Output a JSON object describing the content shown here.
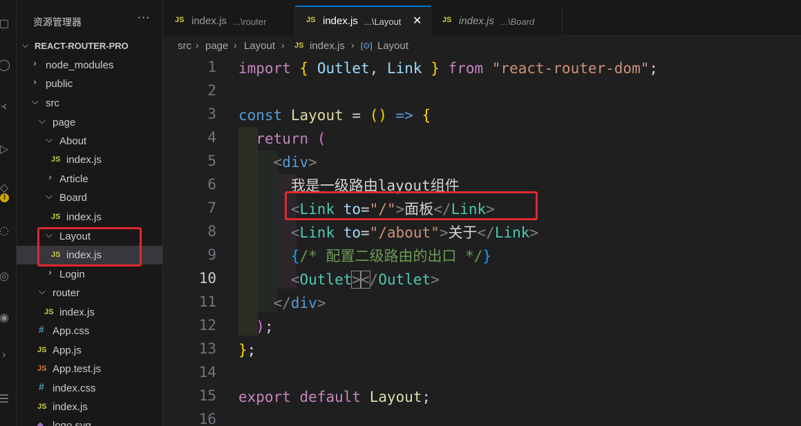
{
  "sidebar": {
    "title": "资源管理器",
    "more": "···",
    "project": "REACT-ROUTER-PRO",
    "items": [
      {
        "label": "node_modules",
        "type": "folder",
        "expanded": false
      },
      {
        "label": "public",
        "type": "folder",
        "expanded": false
      },
      {
        "label": "src",
        "type": "folder",
        "expanded": true
      },
      {
        "label": "page",
        "type": "folder",
        "expanded": true
      },
      {
        "label": "About",
        "type": "folder",
        "expanded": true
      },
      {
        "label": "index.js",
        "type": "js"
      },
      {
        "label": "Article",
        "type": "folder",
        "expanded": false
      },
      {
        "label": "Board",
        "type": "folder",
        "expanded": true
      },
      {
        "label": "index.js",
        "type": "js"
      },
      {
        "label": "Layout",
        "type": "folder",
        "expanded": true
      },
      {
        "label": "index.js",
        "type": "js",
        "selected": true
      },
      {
        "label": "Login",
        "type": "folder",
        "expanded": false
      },
      {
        "label": "router",
        "type": "folder",
        "expanded": true
      },
      {
        "label": "index.js",
        "type": "js"
      },
      {
        "label": "App.css",
        "type": "css"
      },
      {
        "label": "App.js",
        "type": "js"
      },
      {
        "label": "App.test.js",
        "type": "jstest"
      },
      {
        "label": "index.css",
        "type": "css"
      },
      {
        "label": "index.js",
        "type": "js"
      },
      {
        "label": "logo.svg",
        "type": "svg"
      }
    ]
  },
  "tabs": [
    {
      "icon": "JS",
      "name": "index.js",
      "desc": "...\\router",
      "active": false
    },
    {
      "icon": "JS",
      "name": "index.js",
      "desc": "...\\Layout",
      "active": true,
      "close": "✕"
    },
    {
      "icon": "JS",
      "name": "index.js",
      "desc": "...\\Board",
      "active": false,
      "italic": true
    }
  ],
  "breadcrumb": {
    "parts": [
      "src",
      "page",
      "Layout",
      "index.js",
      "Layout"
    ],
    "js_icon": "JS",
    "symbol_icon": "[⊙]"
  },
  "editor": {
    "line_numbers": [
      "1",
      "2",
      "3",
      "4",
      "5",
      "6",
      "7",
      "8",
      "9",
      "10",
      "11",
      "12",
      "13",
      "14",
      "15",
      "16"
    ],
    "current_line": "10"
  },
  "colors": {
    "accent": "#0078d4",
    "highlight_box": "#e0282f",
    "editor_bg": "#1f1f1f",
    "sidebar_bg": "#181818"
  },
  "icons": {
    "activity": [
      "explorer-icon",
      "search-icon",
      "source-control-icon",
      "run-debug-icon",
      "extensions-icon",
      "warning-icon",
      "remote-icon",
      "account-icon",
      "settings-icon",
      "arrow-icon",
      "database-icon"
    ]
  }
}
